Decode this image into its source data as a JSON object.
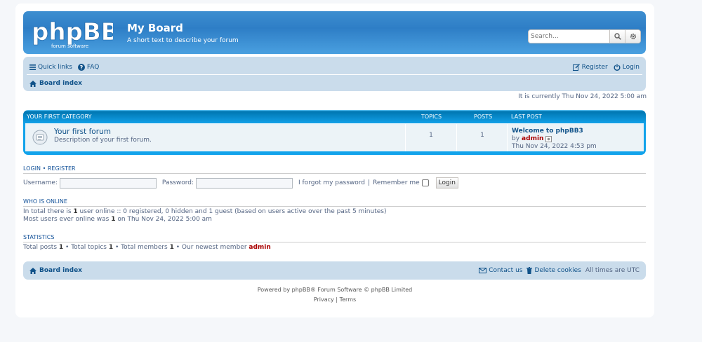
{
  "header": {
    "logo_text": "phpBB",
    "logo_sub": "forum software",
    "site_title": "My Board",
    "site_description": "A short text to describe your forum",
    "search_placeholder": "Search…"
  },
  "nav": {
    "quick_links": "Quick links",
    "faq": "FAQ",
    "register": "Register",
    "login": "Login",
    "breadcrumb": "Board index"
  },
  "current_time": "It is currently Thu Nov 24, 2022 5:00 am",
  "category": {
    "name": "YOUR FIRST CATEGORY",
    "col_topics": "TOPICS",
    "col_posts": "POSTS",
    "col_last_post": "LAST POST",
    "forums": [
      {
        "title": "Your first forum",
        "description": "Description of your first forum.",
        "topics": "1",
        "posts": "1",
        "last_post_title": "Welcome to phpBB3",
        "last_post_by": "by",
        "last_post_author": "admin",
        "last_post_date": "Thu Nov 24, 2022 4:53 pm"
      }
    ]
  },
  "login_section": {
    "title_login": "LOGIN",
    "title_sep": "•",
    "title_register": "REGISTER",
    "username_label": "Username:",
    "password_label": "Password:",
    "forgot": "I forgot my password",
    "sep": "|",
    "remember": "Remember me",
    "button": "Login"
  },
  "who_is_online": {
    "title": "WHO IS ONLINE",
    "line1_pre": "In total there is",
    "line1_count": "1",
    "line1_post": "user online :: 0 registered, 0 hidden and 1 guest (based on users active over the past 5 minutes)",
    "line2_pre": "Most users ever online was",
    "line2_count": "1",
    "line2_post": "on Thu Nov 24, 2022 5:00 am"
  },
  "statistics": {
    "title": "STATISTICS",
    "posts_label": "Total posts",
    "posts": "1",
    "topics_label": "• Total topics",
    "topics": "1",
    "members_label": "• Total members",
    "members": "1",
    "newest_label": "• Our newest member",
    "newest": "admin"
  },
  "footer": {
    "breadcrumb": "Board index",
    "contact": "Contact us",
    "delete_cookies": "Delete cookies",
    "timezone": "All times are",
    "tz": "UTC",
    "powered": "Powered by phpBB® Forum Software © phpBB Limited",
    "privacy": "Privacy",
    "sep": "|",
    "terms": "Terms"
  },
  "colors": {
    "header_blue": "#2e7ec6",
    "nav_bg": "#cadceb",
    "link": "#105289",
    "username": "#aa0000"
  }
}
